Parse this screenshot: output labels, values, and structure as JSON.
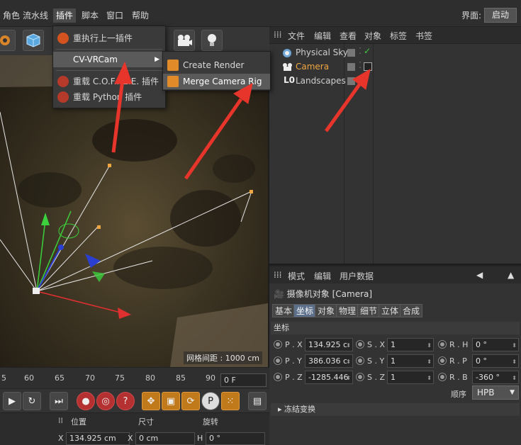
{
  "menubar": {
    "items": [
      "角色",
      "流水线",
      "插件",
      "脚本",
      "窗口",
      "帮助"
    ],
    "layout_label": "界面:",
    "layout_value": "启动"
  },
  "plugins_menu": {
    "items": [
      {
        "label": "重执行上一插件",
        "icon": "plugin-icon"
      },
      {
        "label": "CV-VRCam",
        "icon": "none",
        "submenu": true
      },
      {
        "label": "重载 C.O.F.F.E.E. 插件",
        "icon": "coffee-reload-icon"
      },
      {
        "label": "重载 Python 插件",
        "icon": "python-reload-icon"
      }
    ]
  },
  "submenu": {
    "items": [
      {
        "label": "Create Render Settings",
        "icon": "render-settings-icon"
      },
      {
        "label": "Merge Camera Rig",
        "icon": "camera-rig-icon"
      }
    ]
  },
  "viewport": {
    "grid_label": "网格间距 : 1000 cm"
  },
  "timeline": {
    "ticks": [
      "5",
      "60",
      "65",
      "70",
      "75",
      "80",
      "85",
      "90"
    ],
    "frame": "0 F"
  },
  "coord_bar": {
    "headers": [
      "位置",
      "尺寸",
      "旋转"
    ],
    "x_label": "X",
    "x_pos": "134.925 cm",
    "x_size": "0 cm",
    "h_label": "H",
    "h_rot": "0 °"
  },
  "object_manager": {
    "menu": [
      "文件",
      "编辑",
      "查看",
      "对象",
      "标签",
      "书签"
    ],
    "objects": [
      {
        "name": "Physical Sky",
        "color": "#cfcfcf"
      },
      {
        "name": "Camera",
        "color": "#f0a640"
      },
      {
        "name": "Landscapes",
        "color": "#cfcfcf"
      }
    ]
  },
  "attribute_manager": {
    "menu": [
      "模式",
      "编辑",
      "用户数据"
    ],
    "title": "摄像机对象 [Camera]",
    "tabs": [
      "基本",
      "坐标",
      "对象",
      "物理",
      "细节",
      "立体",
      "合成"
    ],
    "active_tab": "坐标",
    "section": "坐标",
    "rows": [
      {
        "p_label": "P . X",
        "p_val": "134.925 c",
        "s_label": "S . X",
        "s_val": "1",
        "r_label": "R . H",
        "r_val": "0 °"
      },
      {
        "p_label": "P . Y",
        "p_val": "386.036 c",
        "s_label": "S . Y",
        "s_val": "1",
        "r_label": "R . P",
        "r_val": "0 °"
      },
      {
        "p_label": "P . Z",
        "p_val": "-1285.446",
        "s_label": "S . Z",
        "s_val": "1",
        "r_label": "R . B",
        "r_val": "-360 °"
      }
    ],
    "order_label": "顺序",
    "order_value": "HPB",
    "freeze_label": "冻结变换"
  },
  "colors": {
    "accent": "#5b6e8a",
    "annotation_arrow": "#e8352b",
    "camera_highlight": "#f0a640"
  }
}
